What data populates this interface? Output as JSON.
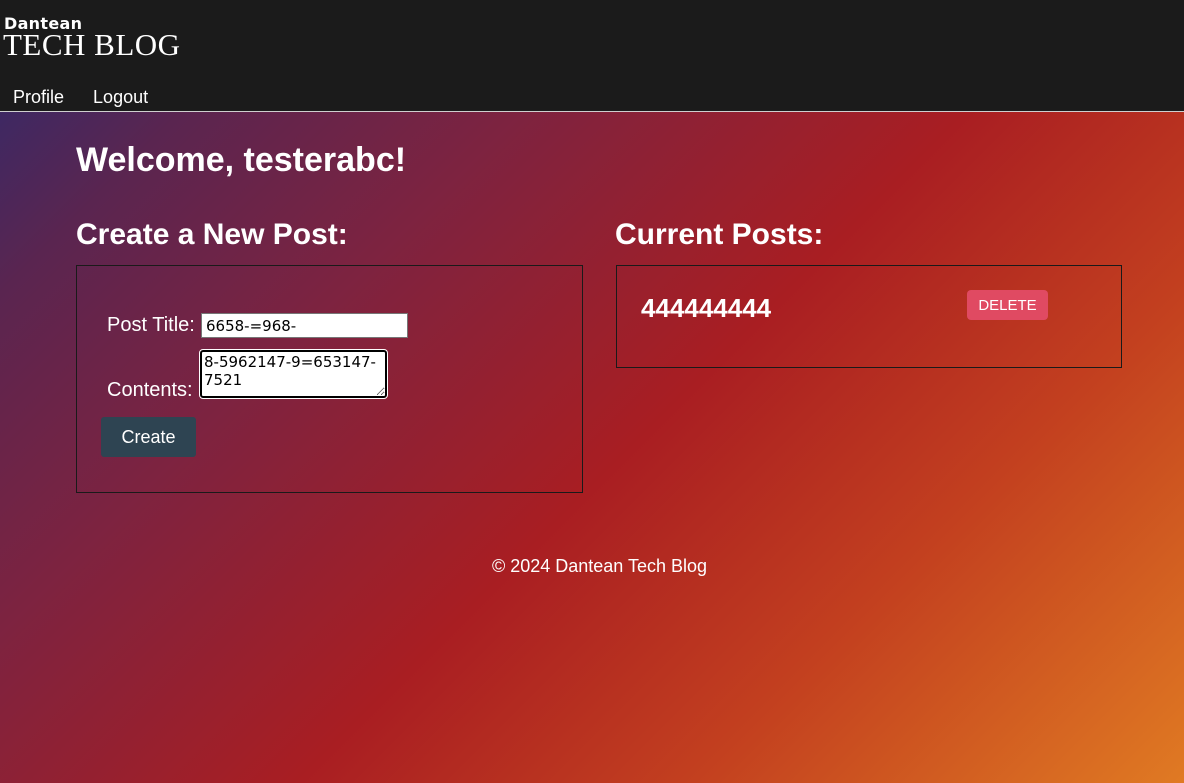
{
  "header": {
    "brand_small": "Dantean",
    "brand_large": "TECH BLOG",
    "nav": {
      "profile_label": "Profile",
      "logout_label": "Logout"
    }
  },
  "main": {
    "welcome": "Welcome, testerabc!",
    "create_section": {
      "heading": "Create a New Post:",
      "title_label": "Post Title:",
      "title_value": "6658-=968-",
      "contents_label": "Contents:",
      "contents_value": "8-5962147-9=653147-7521",
      "create_label": "Create"
    },
    "posts_section": {
      "heading": "Current Posts:",
      "posts": [
        {
          "title": "444444444",
          "delete_label": "DELETE"
        }
      ]
    }
  },
  "footer": {
    "text": "© 2024 Dantean Tech Blog"
  },
  "colors": {
    "header_bg": "#1b1b1b",
    "create_button": "#2e4452",
    "delete_button": "#e04a62"
  }
}
